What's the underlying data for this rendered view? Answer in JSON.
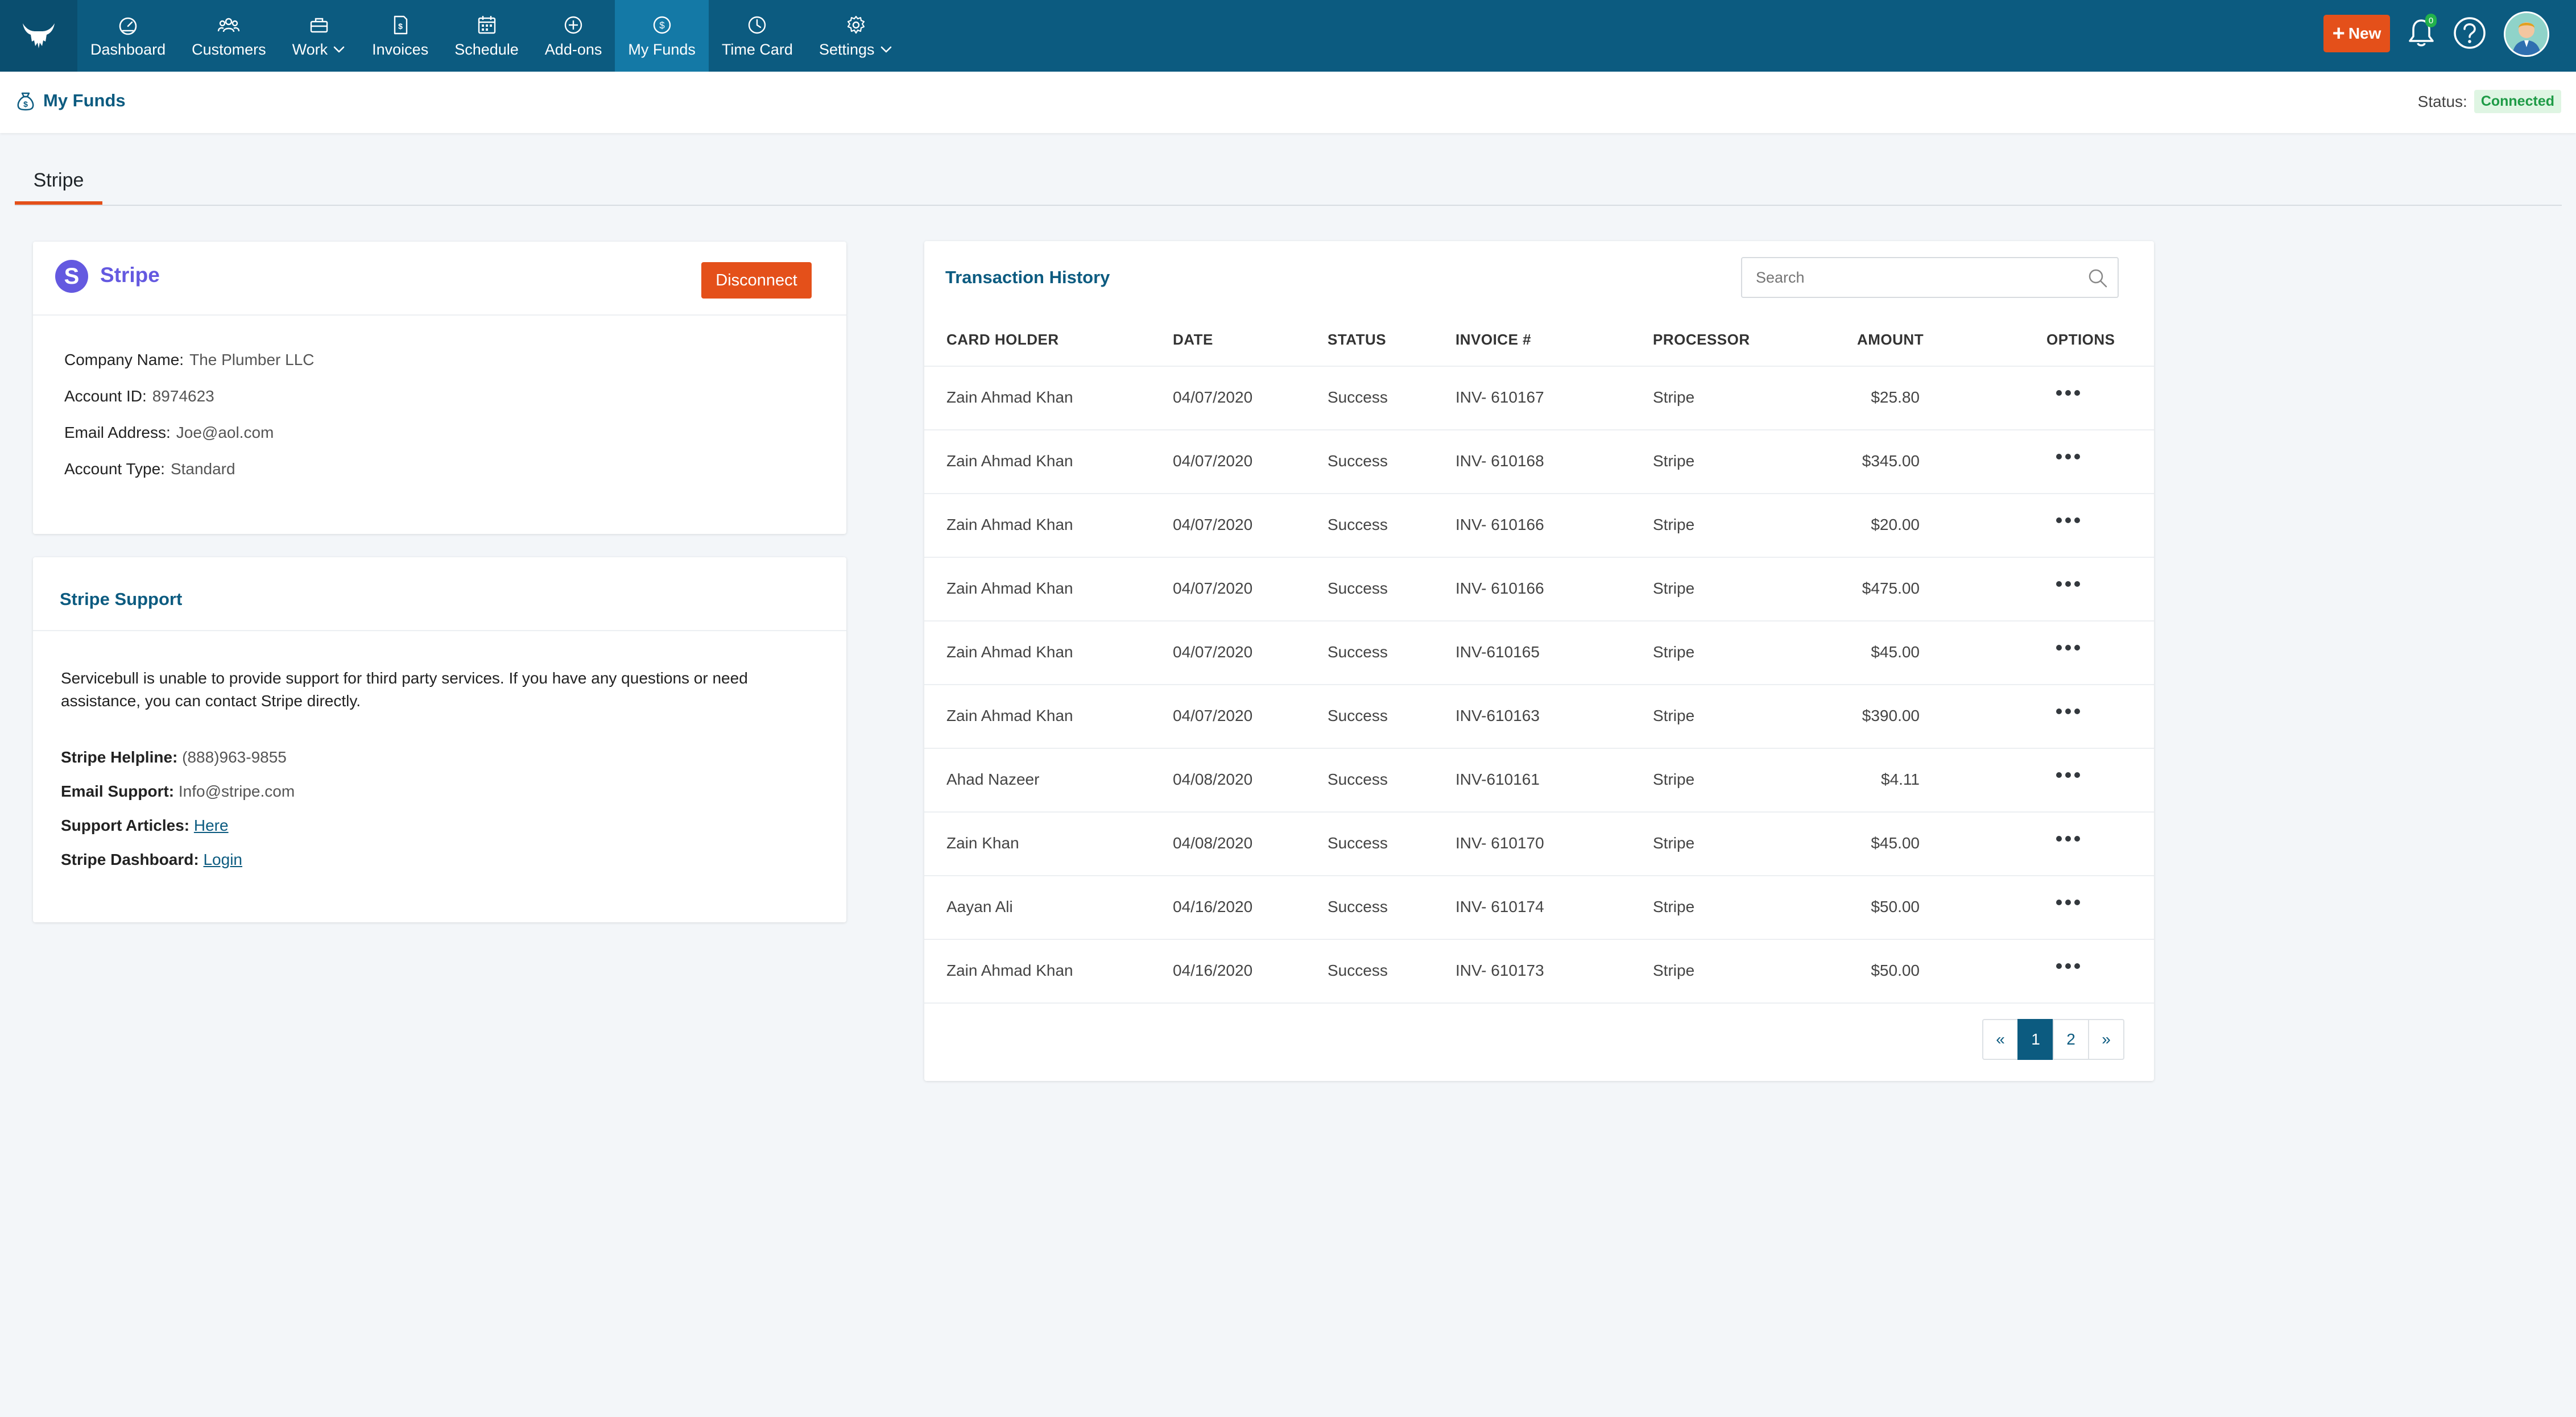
{
  "nav": {
    "items": [
      {
        "label": "Dashboard",
        "icon": "dashboard-icon",
        "active": false,
        "dropdown": false
      },
      {
        "label": "Customers",
        "icon": "customers-icon",
        "active": false,
        "dropdown": false
      },
      {
        "label": "Work",
        "icon": "work-icon",
        "active": false,
        "dropdown": true
      },
      {
        "label": "Invoices",
        "icon": "invoice-icon",
        "active": false,
        "dropdown": false
      },
      {
        "label": "Schedule",
        "icon": "calendar-icon",
        "active": false,
        "dropdown": false
      },
      {
        "label": "Add-ons",
        "icon": "add-icon",
        "active": false,
        "dropdown": false
      },
      {
        "label": "My Funds",
        "icon": "dollar-icon",
        "active": true,
        "dropdown": false
      },
      {
        "label": "Time Card",
        "icon": "clock-icon",
        "active": false,
        "dropdown": false
      },
      {
        "label": "Settings",
        "icon": "gear-icon",
        "active": false,
        "dropdown": true
      }
    ],
    "new_label": "New",
    "notification_count": "0"
  },
  "header": {
    "title": "My Funds",
    "status_label": "Status:",
    "status_value": "Connected"
  },
  "tabs": [
    "Stripe"
  ],
  "stripe": {
    "logo_letter": "S",
    "title": "Stripe",
    "disconnect_label": "Disconnect",
    "fields": [
      {
        "label": "Company Name:",
        "value": "The Plumber LLC"
      },
      {
        "label": "Account ID:",
        "value": "8974623"
      },
      {
        "label": "Email Address:",
        "value": "Joe@aol.com"
      },
      {
        "label": "Account Type:",
        "value": "Standard"
      }
    ]
  },
  "support": {
    "title": "Stripe Support",
    "body": "Servicebull is unable to provide support for third party services. If you have any questions or need assistance, you can contact Stripe directly.",
    "helpline_label": "Stripe Helpline:",
    "helpline_value": "(888)963-9855",
    "email_label": "Email Support:",
    "email_value": "Info@stripe.com",
    "articles_label": "Support Articles:",
    "articles_link": "Here",
    "dashboard_label": "Stripe Dashboard:",
    "dashboard_link": "Login"
  },
  "transactions": {
    "title": "Transaction History",
    "search_placeholder": "Search",
    "columns": [
      "CARD HOLDER",
      "DATE",
      "STATUS",
      "INVOICE #",
      "PROCESSOR",
      "AMOUNT",
      "OPTIONS"
    ],
    "rows": [
      {
        "holder": "Zain Ahmad Khan",
        "date": "04/07/2020",
        "status": "Success",
        "invoice": "INV- 610167",
        "processor": "Stripe",
        "amount": "$25.80"
      },
      {
        "holder": "Zain Ahmad Khan",
        "date": "04/07/2020",
        "status": "Success",
        "invoice": "INV- 610168",
        "processor": "Stripe",
        "amount": "$345.00"
      },
      {
        "holder": "Zain Ahmad Khan",
        "date": "04/07/2020",
        "status": "Success",
        "invoice": "INV- 610166",
        "processor": "Stripe",
        "amount": "$20.00"
      },
      {
        "holder": "Zain Ahmad Khan",
        "date": "04/07/2020",
        "status": "Success",
        "invoice": "INV- 610166",
        "processor": "Stripe",
        "amount": "$475.00"
      },
      {
        "holder": "Zain Ahmad Khan",
        "date": "04/07/2020",
        "status": "Success",
        "invoice": "INV-610165",
        "processor": "Stripe",
        "amount": "$45.00"
      },
      {
        "holder": "Zain Ahmad Khan",
        "date": "04/07/2020",
        "status": "Success",
        "invoice": "INV-610163",
        "processor": "Stripe",
        "amount": "$390.00"
      },
      {
        "holder": "Ahad Nazeer",
        "date": "04/08/2020",
        "status": "Success",
        "invoice": "INV-610161",
        "processor": "Stripe",
        "amount": "$4.11"
      },
      {
        "holder": "Zain Khan",
        "date": "04/08/2020",
        "status": "Success",
        "invoice": "INV- 610170",
        "processor": "Stripe",
        "amount": "$45.00"
      },
      {
        "holder": "Aayan Ali",
        "date": "04/16/2020",
        "status": "Success",
        "invoice": "INV- 610174",
        "processor": "Stripe",
        "amount": "$50.00"
      },
      {
        "holder": "Zain Ahmad Khan",
        "date": "04/16/2020",
        "status": "Success",
        "invoice": "INV- 610173",
        "processor": "Stripe",
        "amount": "$50.00"
      }
    ],
    "pagination": {
      "prev": "«",
      "pages": [
        "1",
        "2"
      ],
      "current": "1",
      "next": "»"
    }
  },
  "colors": {
    "nav_bg": "#0c5b80",
    "nav_active": "#1479a6",
    "accent_orange": "#e4501a",
    "stripe_purple": "#6459e0",
    "status_green": "#1e9b46"
  }
}
